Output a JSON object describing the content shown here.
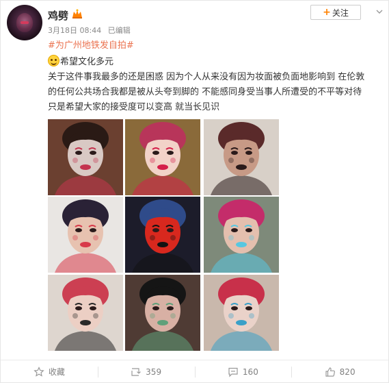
{
  "post": {
    "username": "鸡劈",
    "timestamp": "3月18日 08:44",
    "edited": "已编辑",
    "follow_label": "关注",
    "topic": "#为广州地铁发自拍#",
    "line1": "希望文化多元",
    "paragraph": [
      "关于这件事我最多的还是困惑 因为个人从来没有因为妆面被负面地影响到 在伦敦",
      "的任何公共场合我都是被从头夸到脚的 不能感同身受当事人所遭受的不平等对待",
      "只是希望大家的接受度可以变高 就当长见识"
    ]
  },
  "photos": [
    {
      "name": "photo-1",
      "bg": "#6b4030",
      "face": "#d9c9c4",
      "hair": "#2a1a15",
      "accent": "#c4344f"
    },
    {
      "name": "photo-2",
      "bg": "#8a6a3a",
      "face": "#f2d2c8",
      "hair": "#b8355a",
      "accent": "#d41f4a"
    },
    {
      "name": "photo-3",
      "bg": "#d8d0c8",
      "face": "#c79a86",
      "hair": "#5a2a2a",
      "accent": "#2a1a1a"
    },
    {
      "name": "photo-4",
      "bg": "#e9e6e3",
      "face": "#e7c2b0",
      "hair": "#2a2236",
      "accent": "#d83a4a"
    },
    {
      "name": "photo-5",
      "bg": "#1c1c2a",
      "face": "#d8281e",
      "hair": "#2f4b8a",
      "accent": "#121212"
    },
    {
      "name": "photo-6",
      "bg": "#7e8a7a",
      "face": "#e4bfae",
      "hair": "#c42c6a",
      "accent": "#58c7e0"
    },
    {
      "name": "photo-7",
      "bg": "#ded6cf",
      "face": "#eccfc4",
      "hair": "#cc3f52",
      "accent": "#2a2a2a"
    },
    {
      "name": "photo-8",
      "bg": "#4f3b34",
      "face": "#d8b0a4",
      "hair": "#151515",
      "accent": "#5fa07a"
    },
    {
      "name": "photo-9",
      "bg": "#c9b8ac",
      "face": "#ead2c9",
      "hair": "#c8304a",
      "accent": "#3aa0c8"
    }
  ],
  "actions": {
    "favorite_label": "收藏",
    "repost_count": "359",
    "comment_count": "160",
    "like_count": "820"
  }
}
